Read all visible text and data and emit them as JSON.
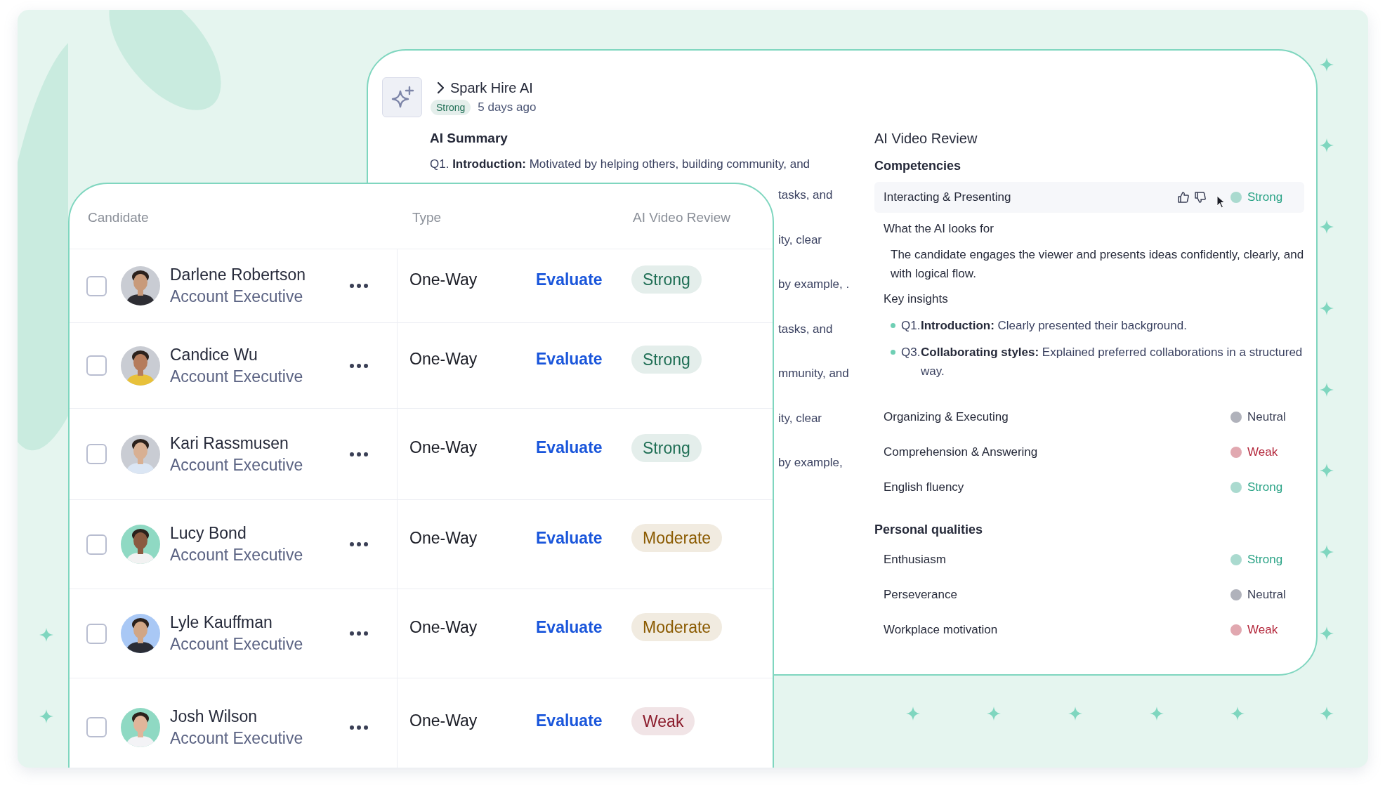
{
  "ai_panel": {
    "title": "Spark Hire AI",
    "badge": {
      "label": "Strong",
      "color": "#1f6f55"
    },
    "time": "5 days ago",
    "summary": {
      "title": "AI Summary",
      "first_line": "Q1. **Introduction:** Motivated by helping others, building community, and",
      "fragments": [
        "tasks, and",
        "ity, clear",
        "by example,  .",
        "tasks, and",
        "mmunity, and",
        "ity, clear",
        "by example,"
      ]
    },
    "review": {
      "title": "AI Video Review",
      "sections": [
        {
          "title": "Competencies",
          "items": [
            {
              "name": "Interacting & Presenting",
              "rating": "Strong",
              "color": "#2aa386",
              "expanded": true,
              "criteria_title": "What the AI looks for",
              "criteria": "The candidate engages the viewer and presents ideas confidently, clearly, and with logical flow.",
              "insights_title": "Key insights",
              "insights": [
                {
                  "number": "Q1.",
                  "text": "**Introduction:** Clearly presented their background."
                },
                {
                  "number": "Q3.",
                  "text": "**Collaborating styles:** Explained preferred collaborations in a structured way."
                }
              ]
            },
            {
              "name": "Organizing & Executing",
              "rating": "Neutral",
              "color": "#3a3f55",
              "expanded": false
            },
            {
              "name": "Comprehension & Answering",
              "rating": "Weak",
              "color": "#b3263a",
              "expanded": false
            },
            {
              "name": "English fluency",
              "rating": "Strong",
              "color": "#2aa386",
              "expanded": false
            }
          ]
        },
        {
          "title": "Personal qualities",
          "items": [
            {
              "name": "Enthusiasm",
              "rating": "Strong",
              "color": "#2aa386",
              "expanded": false
            },
            {
              "name": "Perseverance",
              "rating": "Neutral",
              "color": "#3a3f55",
              "expanded": false
            },
            {
              "name": "Workplace motivation",
              "rating": "Weak",
              "color": "#b3263a",
              "expanded": false
            }
          ]
        }
      ]
    }
  },
  "table": {
    "columns": [
      "Candidate",
      "Type",
      "AI Video Review"
    ],
    "rows": [
      {
        "name": "Darlene Robertson",
        "title": "Account Executive",
        "checked": false,
        "type": "One-Way",
        "action": "Evaluate",
        "review": "Strong",
        "color": "#1f6f55"
      },
      {
        "name": "Candice Wu",
        "title": "Account Executive",
        "checked": false,
        "type": "One-Way",
        "action": "Evaluate",
        "review": "Strong",
        "color": "#1f6f55"
      },
      {
        "name": "Kari Rassmusen",
        "title": "Account Executive",
        "checked": false,
        "type": "One-Way",
        "action": "Evaluate",
        "review": "Strong",
        "color": "#1f6f55"
      },
      {
        "name": "Lucy Bond",
        "title": "Account Executive",
        "checked": false,
        "type": "One-Way",
        "action": "Evaluate",
        "review": "Moderate",
        "color": "#8a5a00"
      },
      {
        "name": "Lyle Kauffman",
        "title": "Account Executive",
        "checked": false,
        "type": "One-Way",
        "action": "Evaluate",
        "review": "Moderate",
        "color": "#8a5a00"
      },
      {
        "name": "Josh Wilson",
        "title": "Account Executive",
        "checked": false,
        "type": "One-Way",
        "action": "Evaluate",
        "review": "Weak",
        "color": "#8b1c2c"
      }
    ]
  }
}
